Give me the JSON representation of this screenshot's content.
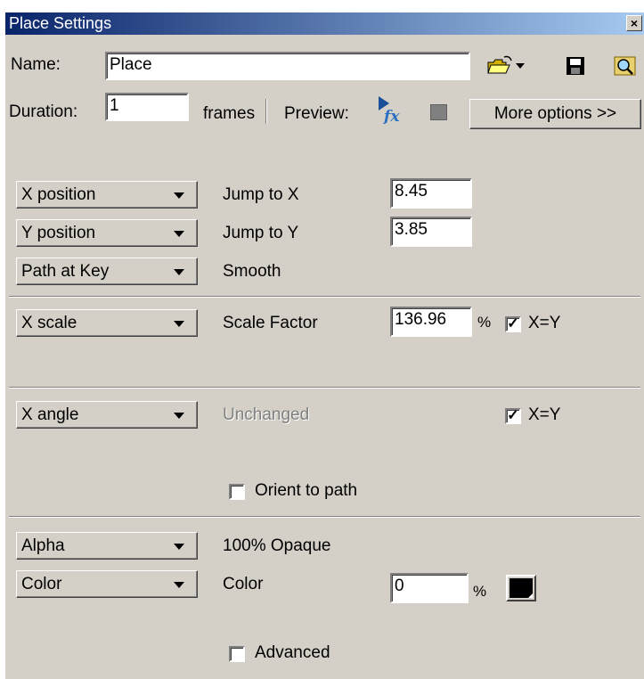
{
  "window": {
    "title": "Place Settings"
  },
  "name": {
    "label": "Name:",
    "value": "Place"
  },
  "duration": {
    "label": "Duration:",
    "value": "1",
    "unit": "frames"
  },
  "preview": {
    "label": "Preview:"
  },
  "more_options": {
    "label": "More options >>"
  },
  "x_position": {
    "dropdown": "X position",
    "label": "Jump to X",
    "value": "8.45"
  },
  "y_position": {
    "dropdown": "Y position",
    "label": "Jump to Y",
    "value": "3.85"
  },
  "path": {
    "dropdown": "Path at Key",
    "label": "Smooth"
  },
  "scale": {
    "dropdown": "X scale",
    "label": "Scale Factor",
    "value": "136.96",
    "unit": "%",
    "lock_label": "X=Y",
    "lock_checked": "✓"
  },
  "angle": {
    "dropdown": "X angle",
    "label": "Unchanged",
    "lock_label": "X=Y",
    "lock_checked": "✓",
    "orient_label": "Orient to path"
  },
  "alpha": {
    "dropdown": "Alpha",
    "label": "100% Opaque"
  },
  "color": {
    "dropdown": "Color",
    "label": "Color",
    "value": "0",
    "unit": "%",
    "swatch": "#000000",
    "advanced_label": "Advanced"
  },
  "colors": {
    "titlebar_start": "#0a246a",
    "titlebar_end": "#a6caf0",
    "face": "#d4d0c8"
  }
}
